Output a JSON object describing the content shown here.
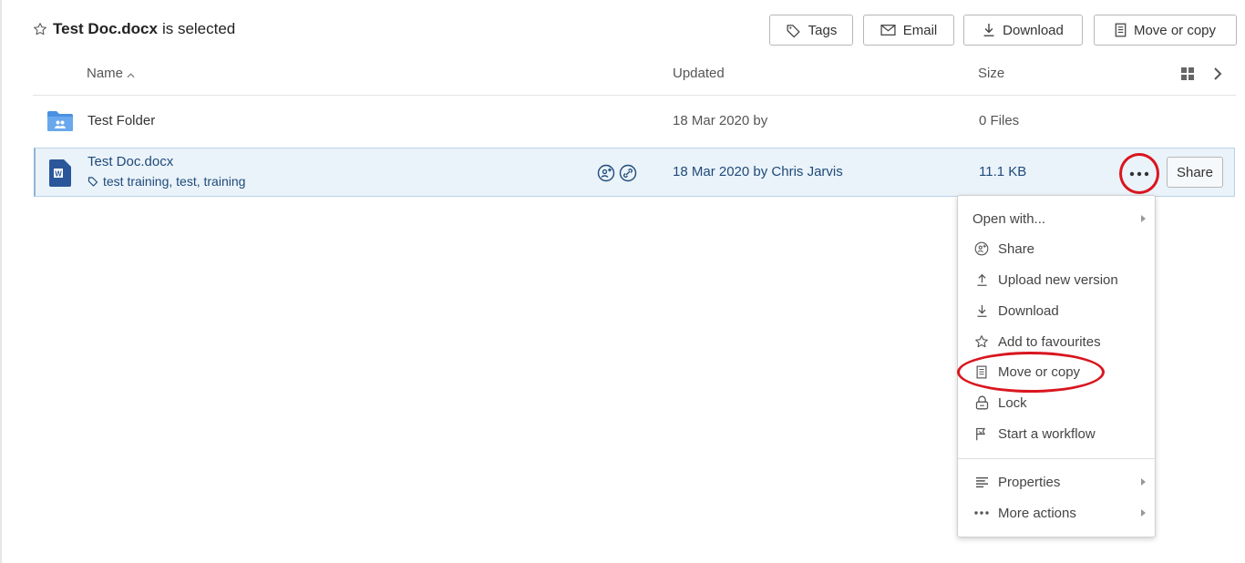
{
  "header": {
    "selected_name": "Test Doc.docx",
    "selected_suffix": "is selected",
    "buttons": {
      "tags": "Tags",
      "email": "Email",
      "download": "Download",
      "move_or_copy": "Move or copy"
    }
  },
  "columns": {
    "name": "Name",
    "updated": "Updated",
    "size": "Size"
  },
  "rows": [
    {
      "name": "Test Folder",
      "updated": "18 Mar 2020 by",
      "size": "0 Files"
    },
    {
      "name": "Test Doc.docx",
      "tags": "test training, test, training",
      "updated": "18 Mar 2020 by Chris Jarvis",
      "size": "11.1 KB",
      "share_label": "Share"
    }
  ],
  "menu": {
    "items": [
      "Open with...",
      "Share",
      "Upload new version",
      "Download",
      "Add to favourites",
      "Move or copy",
      "Lock",
      "Start a workflow",
      "Properties",
      "More actions"
    ]
  },
  "colors": {
    "accent": "#1f4a78",
    "highlight_ring": "#d9161f",
    "selected_row": "#eaf3fa",
    "folder": "#4a90e2",
    "word_icon": "#2b579a"
  }
}
